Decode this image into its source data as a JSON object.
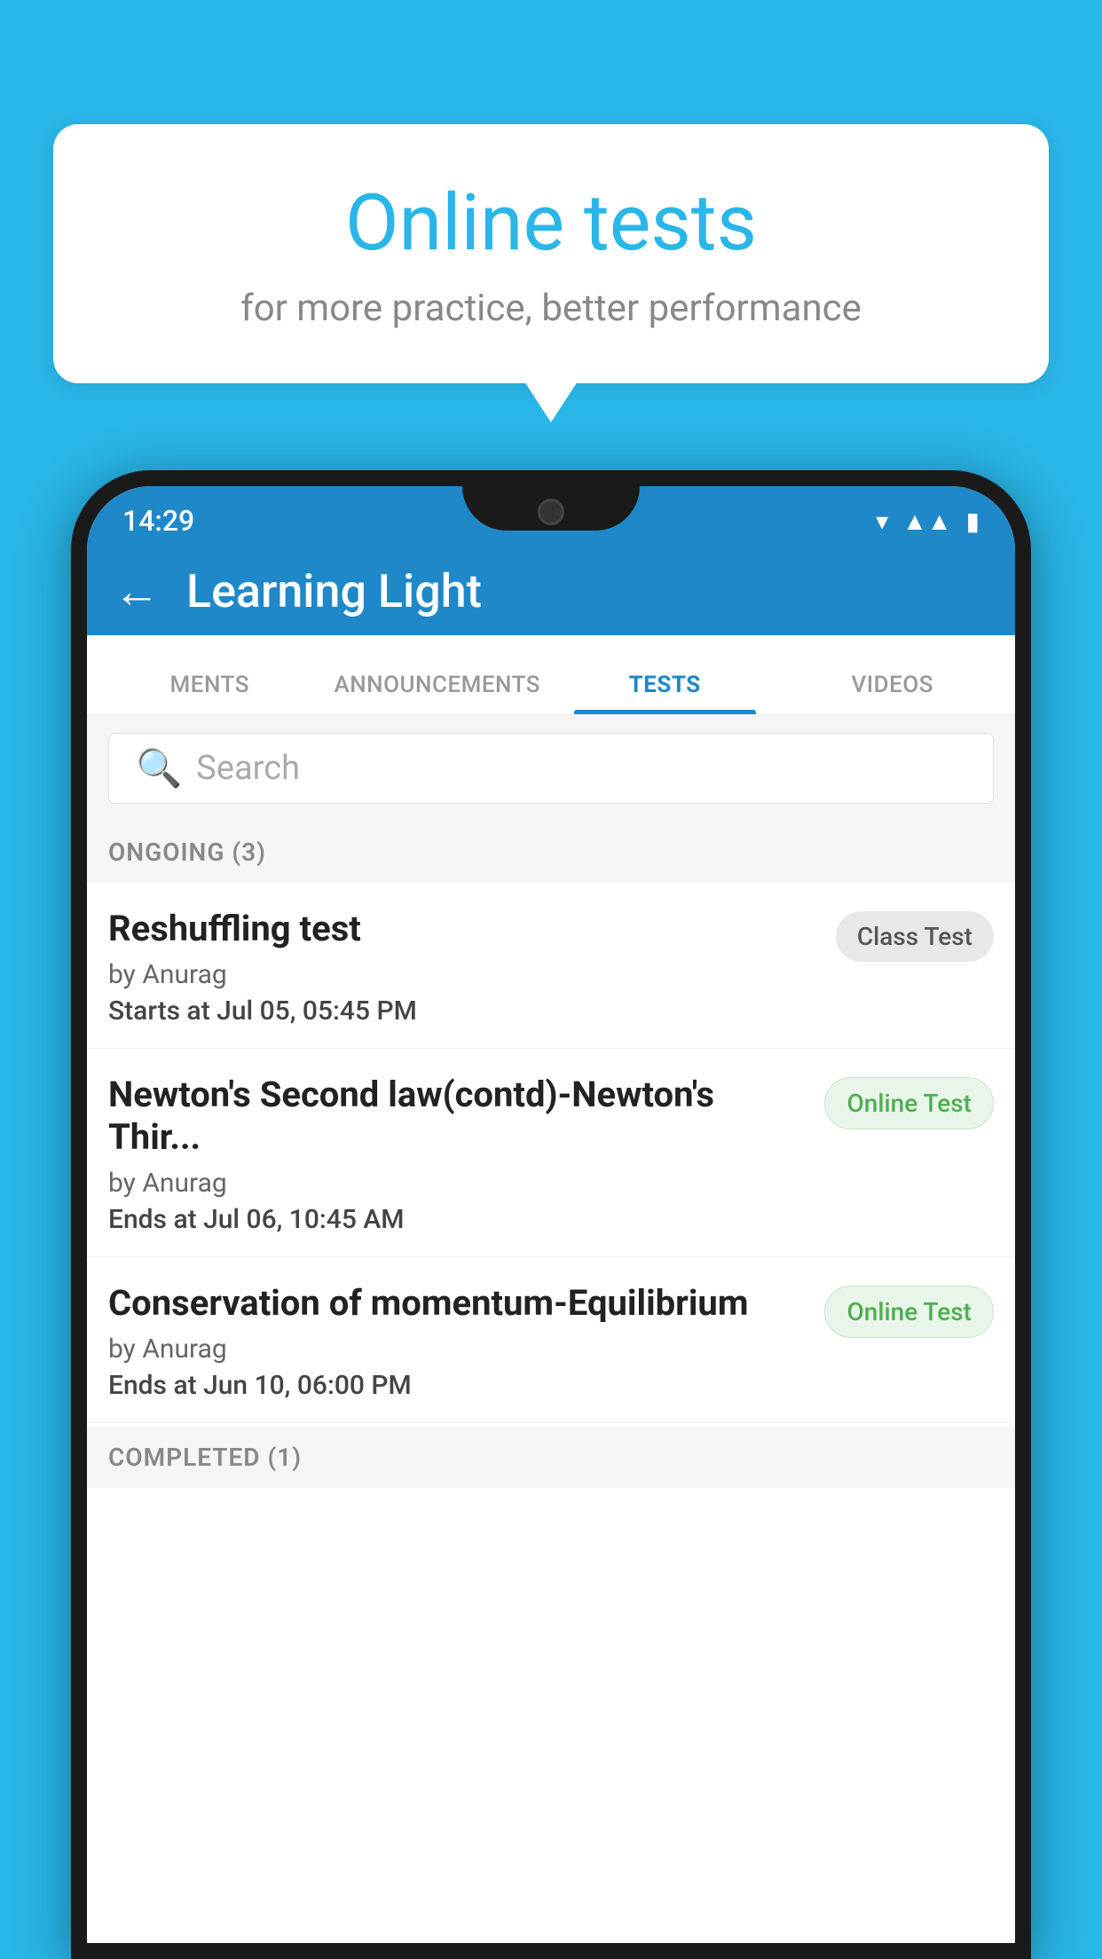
{
  "background": {
    "color": "#29b6e8"
  },
  "speech_bubble": {
    "title": "Online tests",
    "subtitle": "for more practice, better performance"
  },
  "phone": {
    "status_bar": {
      "time": "14:29",
      "icons": [
        "wifi",
        "signal",
        "battery"
      ]
    },
    "header": {
      "title": "Learning Light",
      "back_label": "←"
    },
    "tabs": [
      {
        "label": "MENTS",
        "active": false
      },
      {
        "label": "ANNOUNCEMENTS",
        "active": false
      },
      {
        "label": "TESTS",
        "active": true
      },
      {
        "label": "VIDEOS",
        "active": false
      }
    ],
    "search": {
      "placeholder": "Search"
    },
    "ongoing_section": {
      "title": "ONGOING (3)"
    },
    "tests": [
      {
        "name": "Reshuffling test",
        "author": "by Anurag",
        "time_label": "Starts at",
        "time_value": "Jul 05, 05:45 PM",
        "badge": "Class Test",
        "badge_type": "class"
      },
      {
        "name": "Newton's Second law(contd)-Newton's Thir...",
        "author": "by Anurag",
        "time_label": "Ends at",
        "time_value": "Jul 06, 10:45 AM",
        "badge": "Online Test",
        "badge_type": "online"
      },
      {
        "name": "Conservation of momentum-Equilibrium",
        "author": "by Anurag",
        "time_label": "Ends at",
        "time_value": "Jun 10, 06:00 PM",
        "badge": "Online Test",
        "badge_type": "online"
      }
    ],
    "completed_section": {
      "title": "COMPLETED (1)"
    }
  }
}
